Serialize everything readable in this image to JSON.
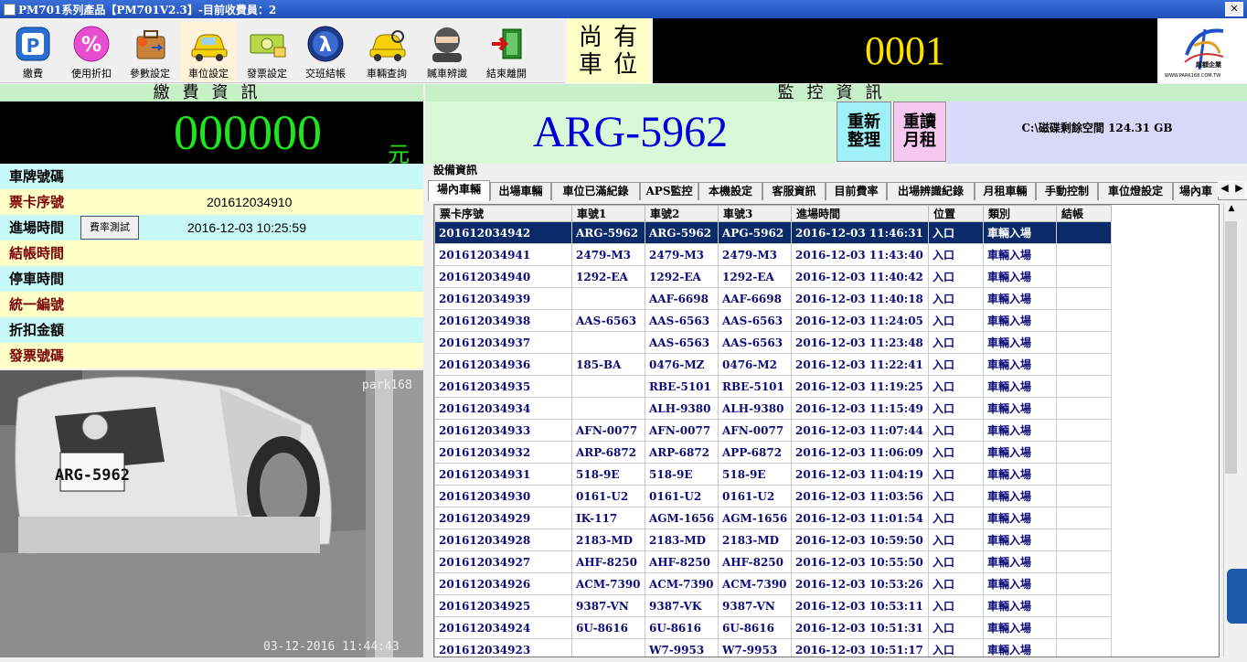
{
  "window": {
    "title": "PM701系列產品【PM701V2.3】-目前收費員：2"
  },
  "toolbar": {
    "items": [
      {
        "label": "繳費",
        "icon": "parking-pay-icon"
      },
      {
        "label": "使用折扣",
        "icon": "discount-percent-icon"
      },
      {
        "label": "參數設定",
        "icon": "settings-toolbox-icon"
      },
      {
        "label": "車位設定",
        "icon": "yellow-car-icon"
      },
      {
        "label": "發票設定",
        "icon": "banknote-icon"
      },
      {
        "label": "交班結帳",
        "icon": "lambda-icon"
      },
      {
        "label": "車輛查詢",
        "icon": "car-search-icon"
      },
      {
        "label": "贓車辨識",
        "icon": "thief-icon"
      },
      {
        "label": "結束離開",
        "icon": "exit-door-icon"
      }
    ]
  },
  "parking": {
    "remaining_label": "尚有車位",
    "remaining_line1": "尚 有",
    "remaining_line2": "車 位",
    "remaining_count": "0001"
  },
  "logo": {
    "brand": "超額企業",
    "url": "WWW.PARK168.COM.TW"
  },
  "fee_panel": {
    "header": "繳費資訊",
    "amount": "000000",
    "unit": "元"
  },
  "monitor_panel": {
    "header": "監控資訊",
    "plate": "ARG-5962",
    "reorg_label": "重新整理",
    "reorg_l1": "重新",
    "reorg_l2": "整理",
    "reread_label": "重讀月租",
    "reread_l1": "重讀",
    "reread_l2": "月租",
    "disk_info": "C:\\磁碟剩餘空間 124.31 GB"
  },
  "info_rows": [
    {
      "key": "車牌號碼",
      "value": ""
    },
    {
      "key": "票卡序號",
      "value": "201612034910"
    },
    {
      "key": "進場時間",
      "value": "2016-12-03 10:25:59"
    },
    {
      "key": "結帳時間",
      "value": ""
    },
    {
      "key": "停車時間",
      "value": ""
    },
    {
      "key": "統一編號",
      "value": ""
    },
    {
      "key": "折扣金額",
      "value": ""
    },
    {
      "key": "發票號碼",
      "value": ""
    }
  ],
  "rate_test_button": "費率測試",
  "camera": {
    "overlay_brand": "park168",
    "timestamp": "03-12-2016 11:44:43",
    "plate_text": "ARG-5962"
  },
  "device_section": {
    "label": "設備資訊"
  },
  "tabs": [
    "場內車輛",
    "出場車輛",
    "車位已滿紀錄",
    "APS監控",
    "本機設定",
    "客服資訊",
    "目前費率",
    "出場辨識紀錄",
    "月租車輛",
    "手動控制",
    "車位燈設定",
    "場內車"
  ],
  "table": {
    "columns": [
      "票卡序號",
      "車號1",
      "車號2",
      "車號3",
      "進場時間",
      "位置",
      "類別",
      "結帳"
    ],
    "rows": [
      [
        "201612034942",
        "ARG-5962",
        "ARG-5962",
        "APG-5962",
        "2016-12-03 11:46:31",
        "入口",
        "車輛入場",
        ""
      ],
      [
        "201612034941",
        "2479-M3",
        "2479-M3",
        "2479-M3",
        "2016-12-03 11:43:40",
        "入口",
        "車輛入場",
        ""
      ],
      [
        "201612034940",
        "1292-EA",
        "1292-EA",
        "1292-EA",
        "2016-12-03 11:40:42",
        "入口",
        "車輛入場",
        ""
      ],
      [
        "201612034939",
        "",
        "AAF-6698",
        "AAF-6698",
        "2016-12-03 11:40:18",
        "入口",
        "車輛入場",
        ""
      ],
      [
        "201612034938",
        "AAS-6563",
        "AAS-6563",
        "AAS-6563",
        "2016-12-03 11:24:05",
        "入口",
        "車輛入場",
        ""
      ],
      [
        "201612034937",
        "",
        "AAS-6563",
        "AAS-6563",
        "2016-12-03 11:23:48",
        "入口",
        "車輛入場",
        ""
      ],
      [
        "201612034936",
        "185-BA",
        "0476-MZ",
        "0476-M2",
        "2016-12-03 11:22:41",
        "入口",
        "車輛入場",
        ""
      ],
      [
        "201612034935",
        "",
        "RBE-5101",
        "RBE-5101",
        "2016-12-03 11:19:25",
        "入口",
        "車輛入場",
        ""
      ],
      [
        "201612034934",
        "",
        "ALH-9380",
        "ALH-9380",
        "2016-12-03 11:15:49",
        "入口",
        "車輛入場",
        ""
      ],
      [
        "201612034933",
        "AFN-0077",
        "AFN-0077",
        "AFN-0077",
        "2016-12-03 11:07:44",
        "入口",
        "車輛入場",
        ""
      ],
      [
        "201612034932",
        "ARP-6872",
        "ARP-6872",
        "APP-6872",
        "2016-12-03 11:06:09",
        "入口",
        "車輛入場",
        ""
      ],
      [
        "201612034931",
        "518-9E",
        "518-9E",
        "518-9E",
        "2016-12-03 11:04:19",
        "入口",
        "車輛入場",
        ""
      ],
      [
        "201612034930",
        "0161-U2",
        "0161-U2",
        "0161-U2",
        "2016-12-03 11:03:56",
        "入口",
        "車輛入場",
        ""
      ],
      [
        "201612034929",
        "IK-117",
        "AGM-1656",
        "AGM-1656",
        "2016-12-03 11:01:54",
        "入口",
        "車輛入場",
        ""
      ],
      [
        "201612034928",
        "2183-MD",
        "2183-MD",
        "2183-MD",
        "2016-12-03 10:59:50",
        "入口",
        "車輛入場",
        ""
      ],
      [
        "201612034927",
        "AHF-8250",
        "AHF-8250",
        "AHF-8250",
        "2016-12-03 10:55:50",
        "入口",
        "車輛入場",
        ""
      ],
      [
        "201612034926",
        "ACM-7390",
        "ACM-7390",
        "ACM-7390",
        "2016-12-03 10:53:26",
        "入口",
        "車輛入場",
        ""
      ],
      [
        "201612034925",
        "9387-VN",
        "9387-VK",
        "9387-VN",
        "2016-12-03 10:53:11",
        "入口",
        "車輛入場",
        ""
      ],
      [
        "201612034924",
        "6U-8616",
        "6U-8616",
        "6U-8616",
        "2016-12-03 10:51:31",
        "入口",
        "車輛入場",
        ""
      ],
      [
        "201612034923",
        "",
        "W7-9953",
        "W7-9953",
        "2016-12-03 10:51:17",
        "入口",
        "車輛入場",
        ""
      ]
    ]
  },
  "colors": {
    "title_bar": "#1f4fb8",
    "amount_green": "#1ee61e",
    "count_yellow": "#ffe000",
    "plate_blue": "#0000d8",
    "selected_row": "#0a2a6a"
  }
}
